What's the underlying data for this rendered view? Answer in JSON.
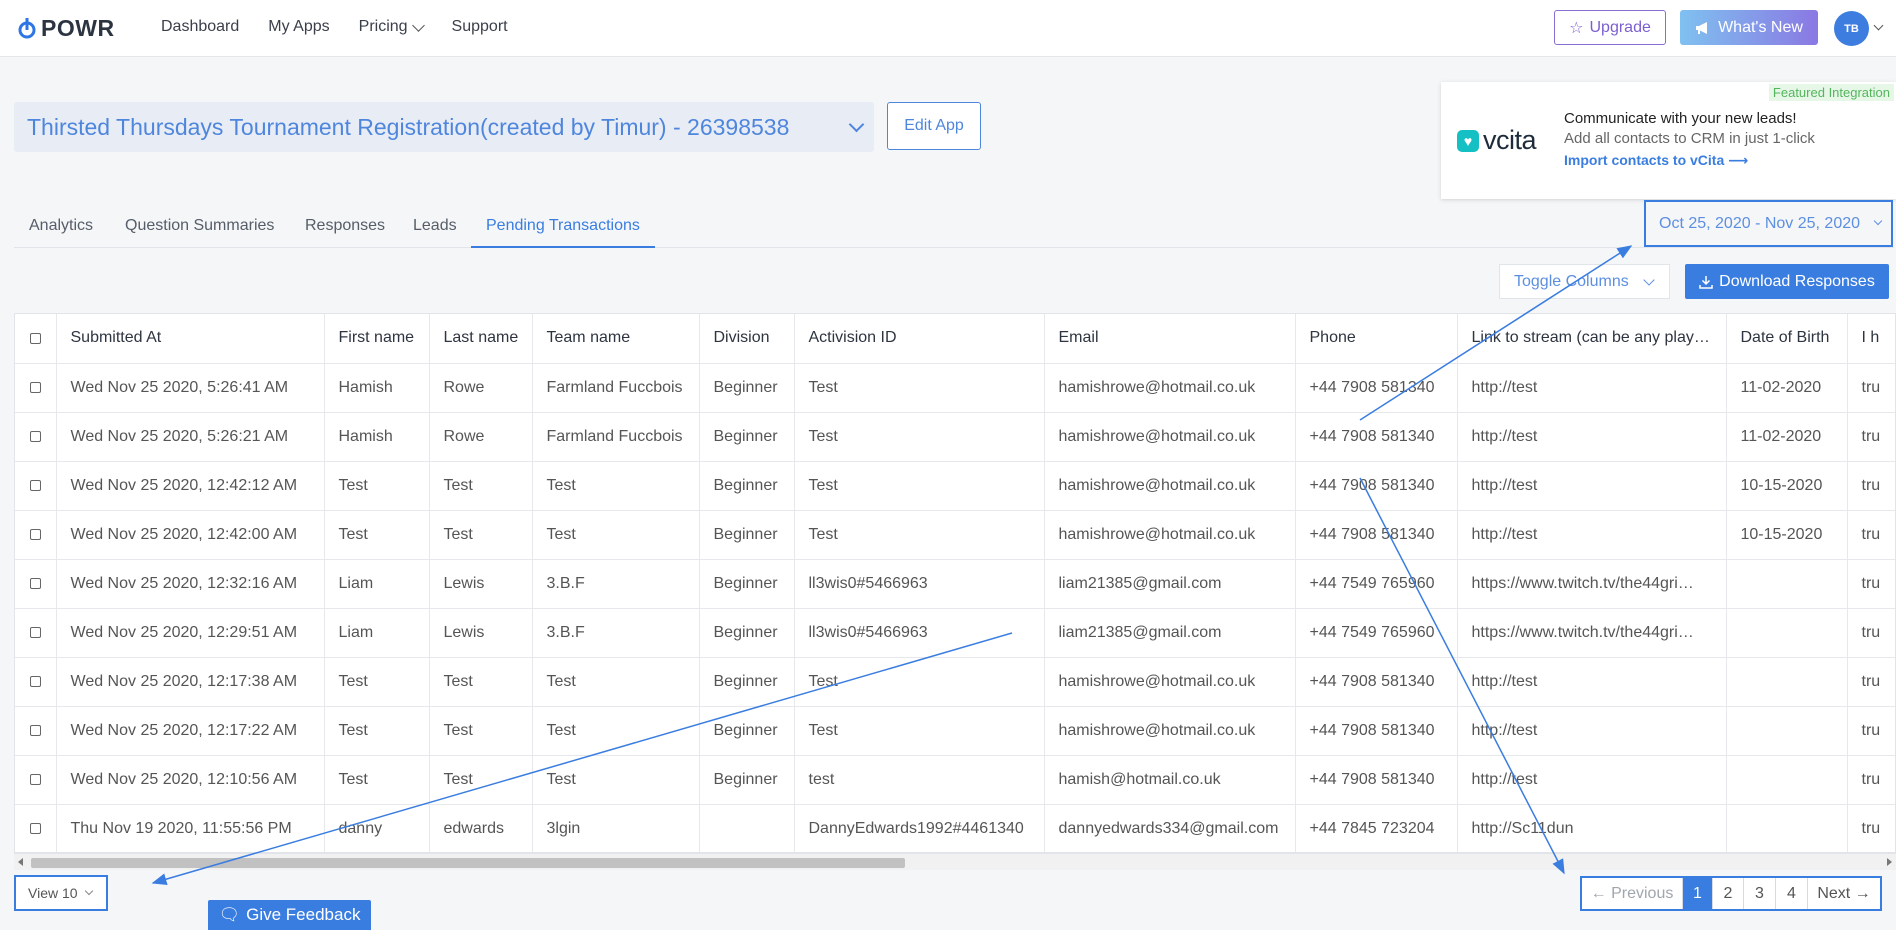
{
  "brand": {
    "name": "POWR"
  },
  "nav": {
    "items": [
      "Dashboard",
      "My Apps",
      "Pricing",
      "Support"
    ]
  },
  "header": {
    "upgrade": "Upgrade",
    "whats_new": "What's New",
    "avatar": "TB"
  },
  "app": {
    "title": "Thirsted Thursdays Tournament Registration(created by Timur) - 26398538",
    "edit": "Edit App"
  },
  "integration": {
    "tag": "Featured Integration",
    "logo": "vcita",
    "title": "Communicate with your new leads!",
    "subtitle": "Add all contacts to CRM in just 1-click",
    "link": "Import contacts to vCita ⟶"
  },
  "tabs": [
    "Analytics",
    "Question Summaries",
    "Responses",
    "Leads",
    "Pending Transactions"
  ],
  "date_range": "Oct 25, 2020 - Nov 25, 2020",
  "toolbar": {
    "toggle_columns": "Toggle Columns",
    "download": "Download Responses"
  },
  "table": {
    "columns": [
      "Submitted At",
      "First name",
      "Last name",
      "Team name",
      "Division",
      "Activision ID",
      "Email",
      "Phone",
      "Link to stream (can be any play…",
      "Date of Birth",
      "I h"
    ],
    "rows": [
      [
        "Wed Nov 25 2020, 5:26:41 AM",
        "Hamish",
        "Rowe",
        "Farmland Fuccbois",
        "Beginner",
        "Test",
        "hamishrowe@hotmail.co.uk",
        "+44 7908 581340",
        "http://test",
        "11-02-2020",
        "tru"
      ],
      [
        "Wed Nov 25 2020, 5:26:21 AM",
        "Hamish",
        "Rowe",
        "Farmland Fuccbois",
        "Beginner",
        "Test",
        "hamishrowe@hotmail.co.uk",
        "+44 7908 581340",
        "http://test",
        "11-02-2020",
        "tru"
      ],
      [
        "Wed Nov 25 2020, 12:42:12 AM",
        "Test",
        "Test",
        "Test",
        "Beginner",
        "Test",
        "hamishrowe@hotmail.co.uk",
        "+44 7908 581340",
        "http://test",
        "10-15-2020",
        "tru"
      ],
      [
        "Wed Nov 25 2020, 12:42:00 AM",
        "Test",
        "Test",
        "Test",
        "Beginner",
        "Test",
        "hamishrowe@hotmail.co.uk",
        "+44 7908 581340",
        "http://test",
        "10-15-2020",
        "tru"
      ],
      [
        "Wed Nov 25 2020, 12:32:16 AM",
        "Liam",
        "Lewis",
        "3.B.F",
        "Beginner",
        "ll3wis0#5466963",
        "liam21385@gmail.com",
        "+44 7549 765960",
        "https://www.twitch.tv/the44gri…",
        "",
        "tru"
      ],
      [
        "Wed Nov 25 2020, 12:29:51 AM",
        "Liam",
        "Lewis",
        "3.B.F",
        "Beginner",
        "ll3wis0#5466963",
        "liam21385@gmail.com",
        "+44 7549 765960",
        "https://www.twitch.tv/the44gri…",
        "",
        "tru"
      ],
      [
        "Wed Nov 25 2020, 12:17:38 AM",
        "Test",
        "Test",
        "Test",
        "Beginner",
        "Test",
        "hamishrowe@hotmail.co.uk",
        "+44 7908 581340",
        "http://test",
        "",
        "tru"
      ],
      [
        "Wed Nov 25 2020, 12:17:22 AM",
        "Test",
        "Test",
        "Test",
        "Beginner",
        "Test",
        "hamishrowe@hotmail.co.uk",
        "+44 7908 581340",
        "http://test",
        "",
        "tru"
      ],
      [
        "Wed Nov 25 2020, 12:10:56 AM",
        "Test",
        "Test",
        "Test",
        "Beginner",
        "test",
        "hamish@hotmail.co.uk",
        "+44 7908 581340",
        "http://test",
        "",
        "tru"
      ],
      [
        "Thu Nov 19 2020, 11:55:56 PM",
        "danny",
        "edwards",
        "3lgin",
        "",
        "DannyEdwards1992#4461340",
        "dannyedwards334@gmail.com",
        "+44 7845 723204",
        "http://Sc11dun",
        "",
        "tru"
      ]
    ]
  },
  "footer": {
    "view": "View 10",
    "feedback": "Give Feedback"
  },
  "pagination": {
    "prev": "← Previous",
    "pages": [
      "1",
      "2",
      "3",
      "4"
    ],
    "next": "Next →"
  },
  "colors": {
    "accent": "#3a7de0",
    "brand_purple": "#7b5fcf",
    "vcita": "#15c0c4"
  }
}
